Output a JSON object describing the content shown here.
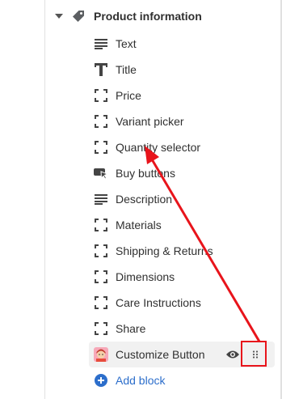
{
  "section": {
    "title": "Product information",
    "icon": "tag-icon"
  },
  "blocks": [
    {
      "label": "Text",
      "icon": "text-lines-icon"
    },
    {
      "label": "Title",
      "icon": "title-t-icon"
    },
    {
      "label": "Price",
      "icon": "dashed-square-icon"
    },
    {
      "label": "Variant picker",
      "icon": "dashed-square-icon"
    },
    {
      "label": "Quantity selector",
      "icon": "dashed-square-icon"
    },
    {
      "label": "Buy buttons",
      "icon": "buy-button-icon"
    },
    {
      "label": "Description",
      "icon": "text-lines-icon"
    },
    {
      "label": "Materials",
      "icon": "dashed-square-icon"
    },
    {
      "label": "Shipping & Returns",
      "icon": "dashed-square-icon"
    },
    {
      "label": "Dimensions",
      "icon": "dashed-square-icon"
    },
    {
      "label": "Care Instructions",
      "icon": "dashed-square-icon"
    },
    {
      "label": "Share",
      "icon": "dashed-square-icon"
    },
    {
      "label": "Customize Button",
      "icon": "app-avatar-icon"
    }
  ],
  "add_block": {
    "label": "Add block",
    "icon": "plus-circle-icon"
  },
  "colors": {
    "annotation_red": "#e8141b",
    "link_blue": "#2c6ecb",
    "active_row_bg": "#f1f1f1"
  }
}
